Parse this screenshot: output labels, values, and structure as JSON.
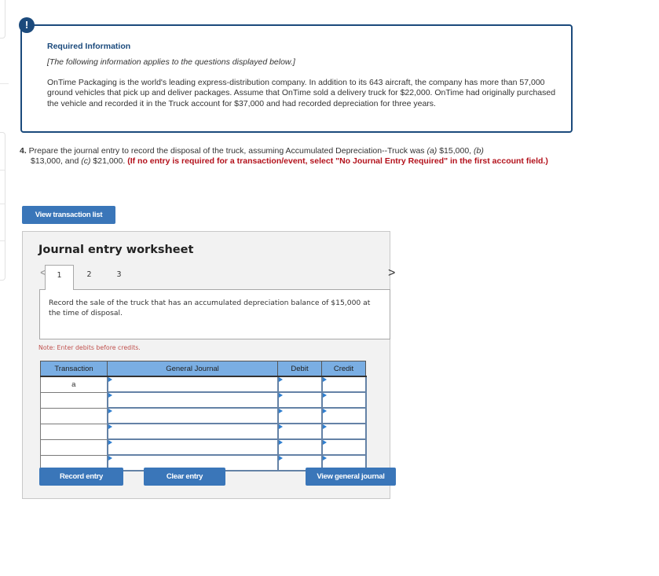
{
  "required_info": {
    "icon": "exclamation-icon",
    "icon_glyph": "!",
    "title": "Required Information",
    "note": "[The following information applies to the questions displayed below.]",
    "body": "OnTime Packaging is the world's leading express-distribution company. In addition to its 643 aircraft, the company has more than 57,000 ground vehicles that pick up and deliver packages. Assume that OnTime sold a delivery truck for $22,000. OnTime had originally purchased the vehicle and recorded it in the Truck account for $37,000 and had recorded depreciation for three years."
  },
  "question": {
    "number": "4.",
    "text_1": " Prepare the journal entry to record the disposal of the truck, assuming Accumulated Depreciation--Truck was ",
    "label_a": "(a)",
    "value_a": " $15,000, ",
    "label_b": "(b)",
    "value_b": " $13,000, and ",
    "label_c": "(c)",
    "value_c": " $21,000. ",
    "instruction": "(If no entry is required for a transaction/event, select \"No Journal Entry Required\" in the first account field.)"
  },
  "buttons": {
    "view_transaction_list": "View transaction list",
    "record_entry": "Record entry",
    "clear_entry": "Clear entry",
    "view_general_journal": "View general journal"
  },
  "worksheet": {
    "title": "Journal entry worksheet",
    "prev_glyph": "<",
    "next_glyph": ">",
    "tabs": [
      {
        "label": "1",
        "active": true
      },
      {
        "label": "2",
        "active": false
      },
      {
        "label": "3",
        "active": false
      }
    ],
    "prompt": "Record the sale of the truck that has an accumulated depreciation balance of $15,000 at the time of disposal.",
    "note": "Note: Enter debits before credits.",
    "table": {
      "headers": [
        "Transaction",
        "General Journal",
        "Debit",
        "Credit"
      ],
      "rows": [
        {
          "transaction": "a",
          "account": "",
          "debit": "",
          "credit": ""
        },
        {
          "transaction": "",
          "account": "",
          "debit": "",
          "credit": ""
        },
        {
          "transaction": "",
          "account": "",
          "debit": "",
          "credit": ""
        },
        {
          "transaction": "",
          "account": "",
          "debit": "",
          "credit": ""
        },
        {
          "transaction": "",
          "account": "",
          "debit": "",
          "credit": ""
        },
        {
          "transaction": "",
          "account": "",
          "debit": "",
          "credit": ""
        }
      ]
    }
  },
  "colors": {
    "accent_navy": "#1b4a7c",
    "button_blue": "#3a76b9",
    "header_blue": "#7aaee3",
    "warning_red": "#b3121c",
    "note_red": "#c0504d"
  }
}
